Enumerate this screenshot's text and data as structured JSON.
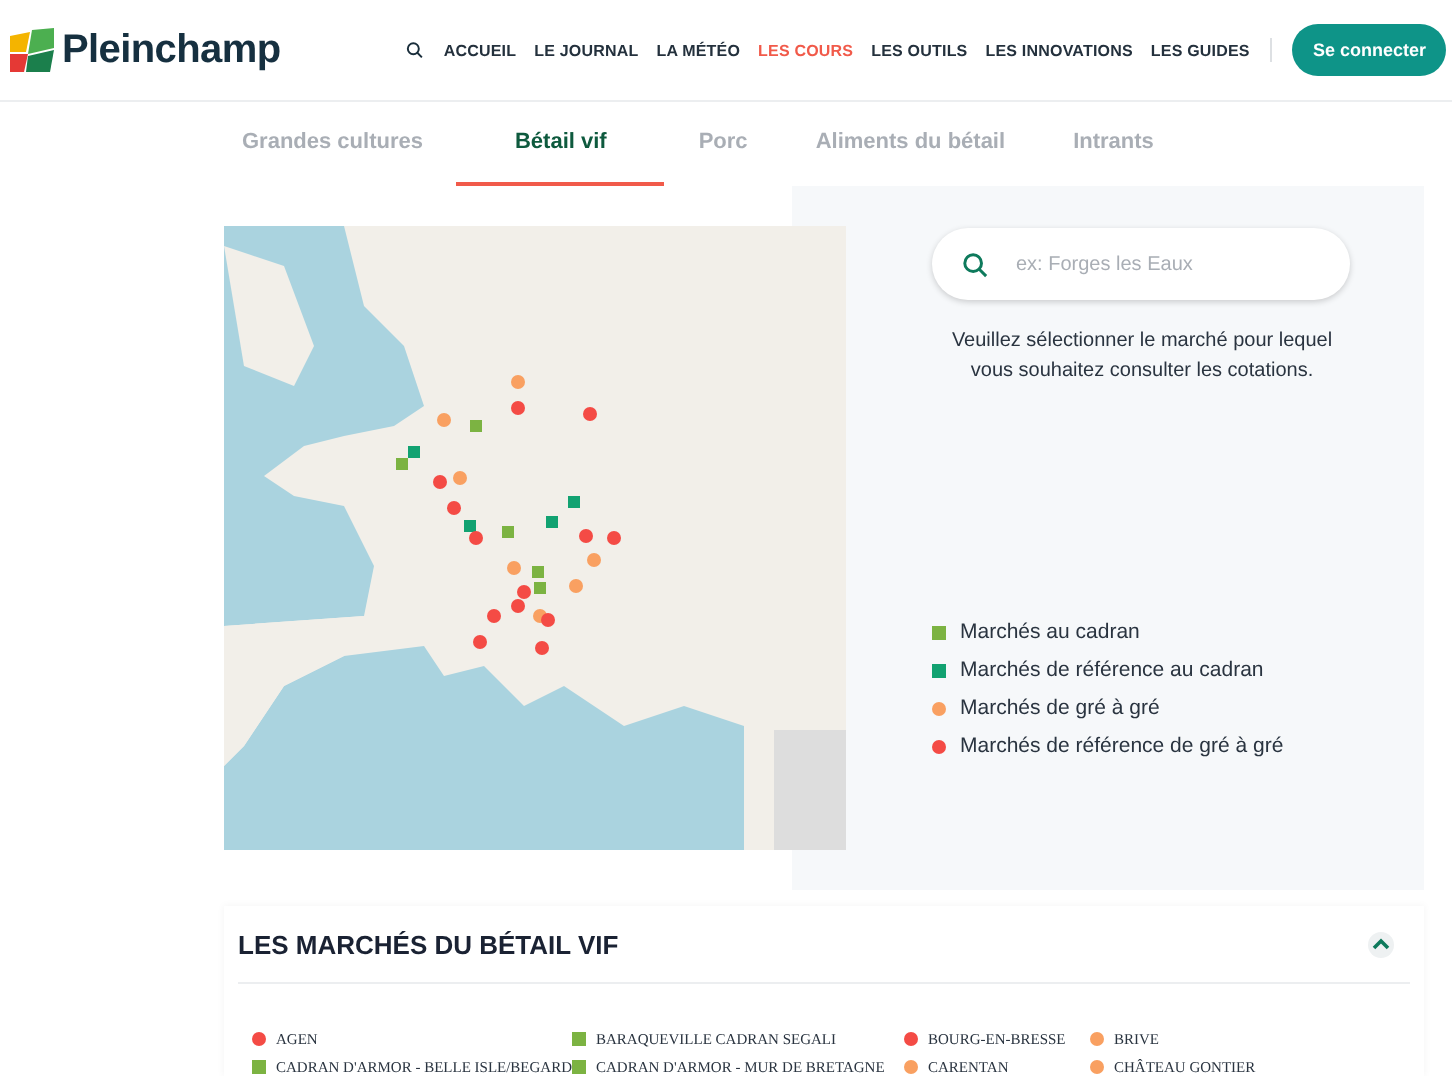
{
  "header": {
    "logo": "Pleinchamp",
    "nav": [
      {
        "label": "ACCUEIL",
        "selected": false
      },
      {
        "label": "LE JOURNAL",
        "selected": false
      },
      {
        "label": "LA MÉTÉO",
        "selected": false
      },
      {
        "label": "LES COURS",
        "selected": true
      },
      {
        "label": "LES OUTILS",
        "selected": false
      },
      {
        "label": "LES INNOVATIONS",
        "selected": false
      },
      {
        "label": "LES GUIDES",
        "selected": false
      }
    ],
    "login_button": "Se connecter"
  },
  "tabs": [
    {
      "label": "Grandes cultures",
      "selected": false
    },
    {
      "label": "Bétail vif",
      "selected": true
    },
    {
      "label": "Porc",
      "selected": false
    },
    {
      "label": "Aliments du bétail",
      "selected": false
    },
    {
      "label": "Intrants",
      "selected": false
    }
  ],
  "search": {
    "placeholder": "ex: Forges les Eaux"
  },
  "instruction": "Veuillez sélectionner le marché pour lequel vous souhaitez consulter les cotations.",
  "legend": [
    {
      "label": "Marchés au cadran",
      "kind": "square",
      "color": "#7cb342"
    },
    {
      "label": "Marchés de référence au cadran",
      "kind": "square",
      "color": "#12a271"
    },
    {
      "label": "Marchés de gré à gré",
      "kind": "circle",
      "color": "#f9a061"
    },
    {
      "label": "Marchés de référence de gré à gré",
      "kind": "circle",
      "color": "#f44b45"
    }
  ],
  "markets_section": {
    "title": "LES MARCHÉS DU BÉTAIL VIF",
    "expanded": true,
    "markets": [
      {
        "name": "AGEN",
        "kind": "circle",
        "color": "#f44b45"
      },
      {
        "name": "BARAQUEVILLE CADRAN SEGALI",
        "kind": "square",
        "color": "#7cb342"
      },
      {
        "name": "BOURG-EN-BRESSE",
        "kind": "circle",
        "color": "#f44b45"
      },
      {
        "name": "BRIVE",
        "kind": "circle",
        "color": "#f9a061"
      },
      {
        "name": "CADRAN D'ARMOR - BELLE ISLE/BEGARD",
        "kind": "square",
        "color": "#7cb342"
      },
      {
        "name": "CADRAN D'ARMOR - MUR DE BRETAGNE",
        "kind": "square",
        "color": "#7cb342"
      },
      {
        "name": "CARENTAN",
        "kind": "circle",
        "color": "#f9a061"
      },
      {
        "name": "CHÂTEAU GONTIER",
        "kind": "circle",
        "color": "#f9a061"
      }
    ]
  }
}
